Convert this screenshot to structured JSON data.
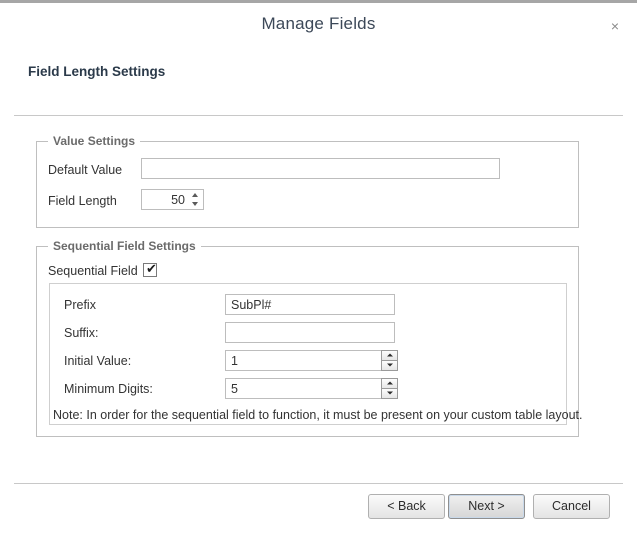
{
  "window": {
    "title": "Manage Fields",
    "close_icon": "close-icon",
    "close_glyph": "×"
  },
  "page": {
    "heading": "Field Length Settings"
  },
  "value_settings": {
    "legend": "Value Settings",
    "default_value": {
      "label": "Default Value",
      "value": "",
      "placeholder": ""
    },
    "field_length": {
      "label": "Field Length",
      "value": "50"
    }
  },
  "sequential_settings": {
    "legend": "Sequential Field Settings",
    "sequential_field": {
      "label": "Sequential Field",
      "checked": true,
      "check_glyph": "✔"
    },
    "prefix": {
      "label": "Prefix",
      "value": "SubPl#"
    },
    "suffix": {
      "label": "Suffix:",
      "value": ""
    },
    "initial_value": {
      "label": "Initial Value:",
      "value": "1"
    },
    "minimum_digits": {
      "label": "Minimum Digits:",
      "value": "5"
    },
    "note": "Note: In order for the sequential field to function, it must be present on your custom table layout."
  },
  "footer": {
    "back_label": "< Back",
    "next_label": "Next >",
    "cancel_label": "Cancel"
  },
  "colors": {
    "title_text": "#3c4858",
    "legend_text": "#6b6b6b",
    "border": "#bfbfbf",
    "separator": "#c8c8c8",
    "top_frame": "#a6a6a6"
  }
}
